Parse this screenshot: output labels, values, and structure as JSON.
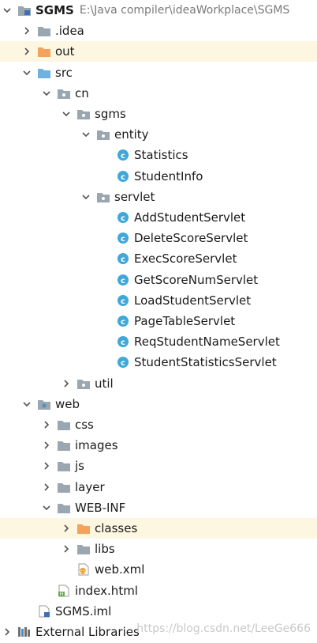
{
  "project": {
    "name": "SGMS",
    "path": "E:\\Java compiler\\ideaWorkplace\\SGMS"
  },
  "tree": [
    {
      "label": "SGMS",
      "depth": 0,
      "arrow": "down",
      "icon": "module-folder",
      "bold": true,
      "path_bind": true
    },
    {
      "label": ".idea",
      "depth": 1,
      "arrow": "right",
      "icon": "folder"
    },
    {
      "label": "out",
      "depth": 1,
      "arrow": "right",
      "icon": "folder-orange",
      "highlight": true
    },
    {
      "label": "src",
      "depth": 1,
      "arrow": "down",
      "icon": "folder-source"
    },
    {
      "label": "cn",
      "depth": 2,
      "arrow": "down",
      "icon": "package"
    },
    {
      "label": "sgms",
      "depth": 3,
      "arrow": "down",
      "icon": "package"
    },
    {
      "label": "entity",
      "depth": 4,
      "arrow": "down",
      "icon": "package"
    },
    {
      "label": "Statistics",
      "depth": 5,
      "arrow": "none",
      "icon": "class"
    },
    {
      "label": "StudentInfo",
      "depth": 5,
      "arrow": "none",
      "icon": "class"
    },
    {
      "label": "servlet",
      "depth": 4,
      "arrow": "down",
      "icon": "package"
    },
    {
      "label": "AddStudentServlet",
      "depth": 5,
      "arrow": "none",
      "icon": "class"
    },
    {
      "label": "DeleteScoreServlet",
      "depth": 5,
      "arrow": "none",
      "icon": "class"
    },
    {
      "label": "ExecScoreServlet",
      "depth": 5,
      "arrow": "none",
      "icon": "class"
    },
    {
      "label": "GetScoreNumServlet",
      "depth": 5,
      "arrow": "none",
      "icon": "class"
    },
    {
      "label": "LoadStudentServlet",
      "depth": 5,
      "arrow": "none",
      "icon": "class"
    },
    {
      "label": "PageTableServlet",
      "depth": 5,
      "arrow": "none",
      "icon": "class"
    },
    {
      "label": "ReqStudentNameServlet",
      "depth": 5,
      "arrow": "none",
      "icon": "class"
    },
    {
      "label": "StudentStatisticsServlet",
      "depth": 5,
      "arrow": "none",
      "icon": "class"
    },
    {
      "label": "util",
      "depth": 3,
      "arrow": "right",
      "icon": "package"
    },
    {
      "label": "web",
      "depth": 1,
      "arrow": "down",
      "icon": "folder-web"
    },
    {
      "label": "css",
      "depth": 2,
      "arrow": "right",
      "icon": "folder"
    },
    {
      "label": "images",
      "depth": 2,
      "arrow": "right",
      "icon": "folder"
    },
    {
      "label": "js",
      "depth": 2,
      "arrow": "right",
      "icon": "folder"
    },
    {
      "label": "layer",
      "depth": 2,
      "arrow": "right",
      "icon": "folder"
    },
    {
      "label": "WEB-INF",
      "depth": 2,
      "arrow": "down",
      "icon": "folder"
    },
    {
      "label": "classes",
      "depth": 3,
      "arrow": "right",
      "icon": "folder-orange",
      "highlight": true
    },
    {
      "label": "libs",
      "depth": 3,
      "arrow": "right",
      "icon": "folder"
    },
    {
      "label": "web.xml",
      "depth": 3,
      "arrow": "none",
      "icon": "xml-file"
    },
    {
      "label": "index.html",
      "depth": 2,
      "arrow": "none",
      "icon": "html-file"
    },
    {
      "label": "SGMS.iml",
      "depth": 1,
      "arrow": "none",
      "icon": "iml-file"
    },
    {
      "label": "External Libraries",
      "depth": 0,
      "arrow": "right",
      "icon": "libraries"
    }
  ],
  "watermark": "https://blog.csdn.net/LeeGe666",
  "colors": {
    "highlight": "#fdf7e2",
    "folder": "#9aa7b0",
    "folder_orange": "#f4a35c",
    "folder_source": "#6fb2e0",
    "class_badge": "#40a7d9",
    "arrow": "#555555"
  }
}
